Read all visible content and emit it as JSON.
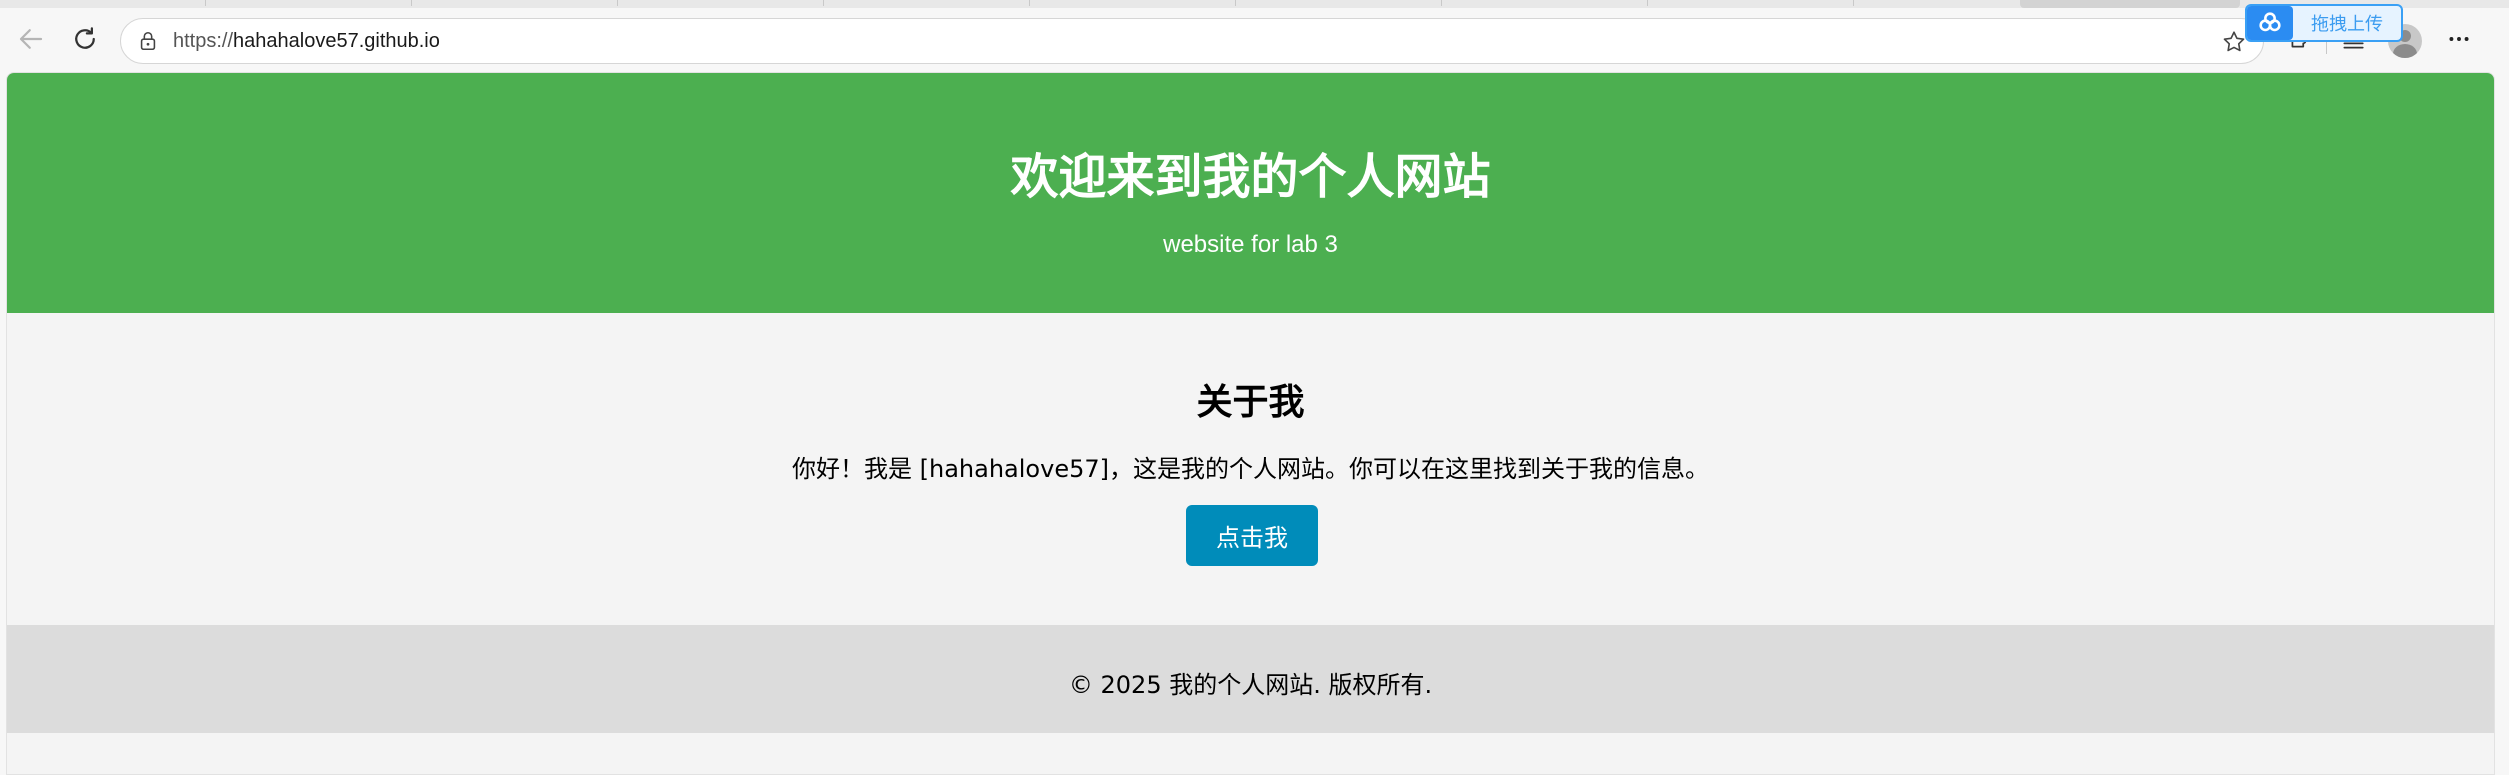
{
  "browser": {
    "url_protocol": "https://",
    "url_host": "hahahalove57.github.io",
    "upload_widget_label": "拖拽上传",
    "icons": {
      "back": "back-arrow-icon",
      "refresh": "refresh-icon",
      "lock": "lock-icon",
      "favorite": "star-icon",
      "extensions": "puzzle-icon",
      "favorites_list": "favorites-list-icon",
      "profile": "avatar",
      "menu": "more-icon",
      "upload": "cloud-upload-icon"
    }
  },
  "header": {
    "title": "欢迎来到我的个人网站",
    "subtitle": "website for lab 3",
    "background": "#4caf50"
  },
  "main": {
    "about_title": "关于我",
    "about_text": "你好！我是 [hahahalove57]，这是我的个人网站。你可以在这里找到关于我的信息。",
    "button_label": "点击我",
    "button_color": "#008cba"
  },
  "footer": {
    "text": "© 2025 我的个人网站. 版权所有.",
    "background": "#dcdcdc"
  }
}
